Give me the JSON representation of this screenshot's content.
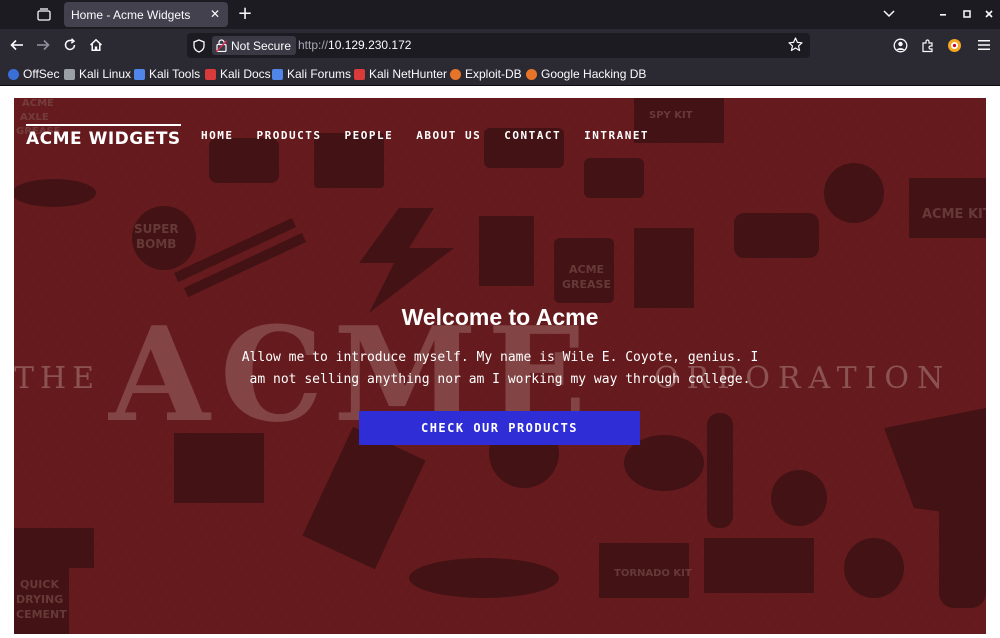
{
  "browser": {
    "tab": {
      "title": "Home - Acme Widgets"
    },
    "address": {
      "security_label": "Not Secure",
      "url_scheme": "http://",
      "url_host": "10.129.230.172"
    },
    "bookmarks": [
      {
        "label": "OffSec",
        "icon_color": "#3b6fd8"
      },
      {
        "label": "Kali Linux",
        "icon_color": "#9aa0a6"
      },
      {
        "label": "Kali Tools",
        "icon_color": "#4f86e8"
      },
      {
        "label": "Kali Docs",
        "icon_color": "#d93a3a"
      },
      {
        "label": "Kali Forums",
        "icon_color": "#4f86e8"
      },
      {
        "label": "Kali NetHunter",
        "icon_color": "#d93a3a"
      },
      {
        "label": "Exploit-DB",
        "icon_color": "#e8742a"
      },
      {
        "label": "Google Hacking DB",
        "icon_color": "#e8742a"
      }
    ]
  },
  "site": {
    "logo": "ACME WIDGETS",
    "nav": [
      "HOME",
      "PRODUCTS",
      "PEOPLE",
      "ABOUT US",
      "CONTACT",
      "INTRANET"
    ],
    "hero": {
      "title": "Welcome to Acme",
      "text": "Allow me to introduce myself. My name is Wile E. Coyote, genius. I am not selling anything nor am I working my way through college.",
      "cta_label": "CHECK OUR PRODUCTS"
    },
    "colors": {
      "hero_bg": "#6e1e21",
      "cta_bg": "#2f2dd6"
    }
  }
}
